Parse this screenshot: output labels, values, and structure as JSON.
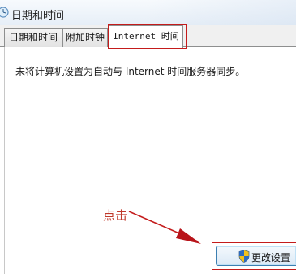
{
  "window": {
    "title": "日期和时间",
    "icon": "datetime-icon"
  },
  "tabs": [
    {
      "label": "日期和时间",
      "active": false
    },
    {
      "label": "附加时钟",
      "active": false
    },
    {
      "label": "Internet 时间",
      "active": true
    }
  ],
  "main": {
    "info_text": "未将计算机设置为自动与 Internet 时间服务器同步。"
  },
  "change_settings_button": {
    "label": "更改设置",
    "icon": "uac-shield-icon"
  },
  "annotation": {
    "label": "点击",
    "color": "#c41b1b"
  }
}
